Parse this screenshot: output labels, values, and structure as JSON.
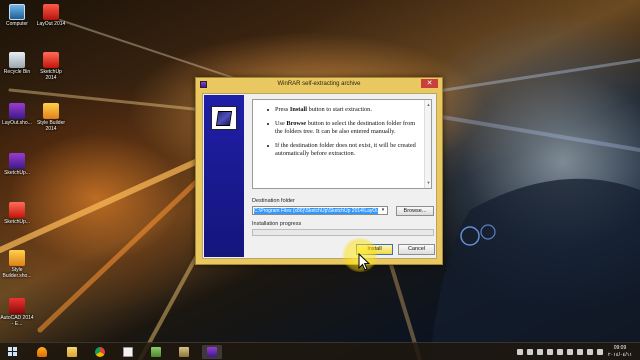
{
  "desktop": {
    "icons": [
      {
        "label": "Computer"
      },
      {
        "label": "LayOut 2014"
      },
      {
        "label": "Recycle Bin"
      },
      {
        "label": "SketchUp 2014"
      },
      {
        "label": "LayOut.sho..."
      },
      {
        "label": "Style Builder 2014"
      },
      {
        "label": "SketchUp..."
      },
      {
        "label": "SketchUp..."
      },
      {
        "label": "Style Builder.sho..."
      },
      {
        "label": "AutoCAD 2014 - E..."
      }
    ]
  },
  "dialog": {
    "title": "WinRAR self-extracting archive",
    "close_glyph": "✕",
    "instructions": [
      {
        "pre": "Press ",
        "bold": "Install",
        "post": " button to start extraction."
      },
      {
        "pre": "Use ",
        "bold": "Browse",
        "post": " button to select the destination folder from the folders tree. It can be also entered manually."
      },
      {
        "pre": "",
        "bold": "",
        "post": "If the destination folder does not exist, it will be created automatically before extraction."
      }
    ],
    "destination_label": "Destination folder",
    "destination_value": "C:\\Program Files (x86)\\SketchUp\\SketchUp 2014\\LayOut",
    "browse_label": "Browse...",
    "progress_label": "Installation progress",
    "progress_fraction": 0,
    "install_label": "Install",
    "cancel_label": "Cancel"
  },
  "taskbar": {
    "items": [
      "start-icon",
      "vlc-icon",
      "file-explorer-icon",
      "chrome-icon",
      "document-icon",
      "folder-icon",
      "media-icon",
      "winrar-icon"
    ],
    "clock_time": "09:09",
    "clock_date": "٢٠١٤/٠٤/١١"
  }
}
